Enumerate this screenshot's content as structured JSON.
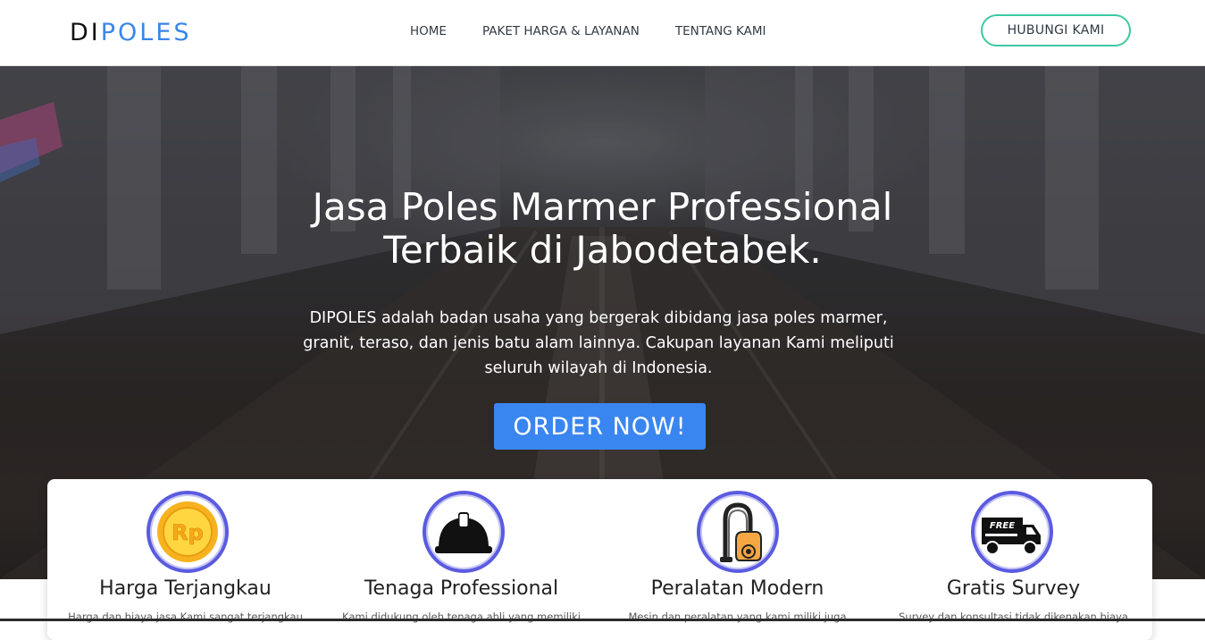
{
  "brand": {
    "part1": "DI",
    "part2": "POLES"
  },
  "nav": {
    "home": "HOME",
    "paket": "PAKET HARGA & LAYANAN",
    "tentang": "TENTANG KAMI",
    "contact_button": "HUBUNGI KAMI"
  },
  "hero": {
    "title_line1": "Jasa Poles Marmer Professional",
    "title_line2": "Terbaik di Jabodetabek.",
    "desc_line1": "DIPOLES adalah badan usaha yang bergerak dibidang jasa poles marmer,",
    "desc_line2": "granit, teraso, dan jenis batu alam lainnya. Cakupan layanan Kami meliputi",
    "desc_line3": "seluruh wilayah di Indonesia.",
    "order_button": "ORDER NOW!"
  },
  "features": [
    {
      "title": "Harga Terjangkau",
      "desc": "Harga dan biaya jasa Kami sangat terjangkau",
      "icon": "rupiah-coin-icon"
    },
    {
      "title": "Tenaga Professional",
      "desc": "Kami didukung oleh tenaga ahli yang memiliki",
      "icon": "hard-hat-icon"
    },
    {
      "title": "Peralatan Modern",
      "desc": "Mesin dan peralatan yang kami miliki juga",
      "icon": "vacuum-cleaner-icon"
    },
    {
      "title": "Gratis Survey",
      "desc": "Survey dan konsultasi tidak dikenakan biaya",
      "icon": "free-delivery-truck-icon"
    }
  ],
  "icon_text": {
    "coin_symbol": "Rp",
    "truck_label": "FREE"
  },
  "colors": {
    "brand_blue": "#3a86e8",
    "accent_teal": "#3cc9a3",
    "order_blue": "#3a86f0",
    "icon_ring": "#5b5be0"
  }
}
